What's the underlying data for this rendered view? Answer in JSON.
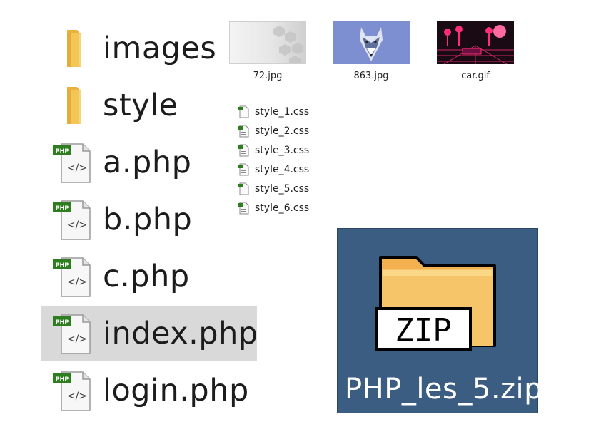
{
  "files_large": [
    {
      "name": "images",
      "type": "folder",
      "icon": "folder-icon",
      "selected": false
    },
    {
      "name": "style",
      "type": "folder",
      "icon": "folder-icon",
      "selected": false
    },
    {
      "name": "a.php",
      "type": "php",
      "icon": "php-file-icon",
      "selected": false
    },
    {
      "name": "b.php",
      "type": "php",
      "icon": "php-file-icon",
      "selected": false
    },
    {
      "name": "c.php",
      "type": "php",
      "icon": "php-file-icon",
      "selected": false
    },
    {
      "name": "index.php",
      "type": "php",
      "icon": "php-file-icon",
      "selected": true
    },
    {
      "name": "login.php",
      "type": "php",
      "icon": "php-file-icon",
      "selected": false
    }
  ],
  "thumbnails": [
    {
      "name": "72.jpg",
      "icon": "image-thumbnail"
    },
    {
      "name": "863.jpg",
      "icon": "wolf-image-thumbnail"
    },
    {
      "name": "car.gif",
      "icon": "car-image-thumbnail"
    }
  ],
  "css_files": [
    {
      "name": "style_1.css",
      "icon": "css-file-icon"
    },
    {
      "name": "style_2.css",
      "icon": "css-file-icon"
    },
    {
      "name": "style_3.css",
      "icon": "css-file-icon"
    },
    {
      "name": "style_4.css",
      "icon": "css-file-icon"
    },
    {
      "name": "style_5.css",
      "icon": "css-file-icon"
    },
    {
      "name": "style_6.css",
      "icon": "css-file-icon"
    }
  ],
  "zip": {
    "name": "PHP_les_5.zip",
    "badge": "ZIP",
    "icon": "zip-folder-icon",
    "selected": true
  },
  "colors": {
    "selection_gray": "#d9d9d9",
    "zip_tile_bg": "#3c5d82",
    "folder_yellow": "#f3c657",
    "php_badge_green": "#2e7d1e"
  }
}
